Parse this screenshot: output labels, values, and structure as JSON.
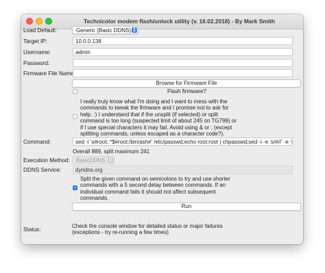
{
  "window": {
    "title": "Technicolor modem flash/unlock utility (v. 16.02.2018) - By Mark Smith"
  },
  "form": {
    "load_default": {
      "label": "Load Default:",
      "selected": "Generic (Basic DDNS)"
    },
    "target_ip": {
      "label": "Target IP:",
      "value": "10.0.0.138"
    },
    "username": {
      "label": "Username:",
      "value": "admin"
    },
    "password": {
      "label": "Password:",
      "value": ""
    },
    "firmware_file": {
      "label": "Firmware File Name:",
      "value": ""
    },
    "browse_button": "Browse for Firmware File",
    "flash_firmware": {
      "label": "Flash firmware?",
      "checked": false
    },
    "disclaimer": {
      "lines": [
        "I really truly know what I'm doing and I want to mess with the",
        "commands to tweak the firmware and I promise not to ask for",
        "help. :)  I understand that if the unsplit (if selected) or split",
        "command is too long (suspected limit of about 245 on TG799) or",
        "if I use special characters it may fail.  Avoid using & or ; (except",
        "splitting commands, unless escaped as a character code?)."
      ],
      "checked": false
    },
    "command": {
      "label": "Command:",
      "value": "sed -i 's#root:.*$#root:/bin/ash#' /etc/passwd;echo root:root | chpasswd;sed -i -e 's/#//' -e 's#",
      "info": "Overall 889, split maximum 241"
    },
    "execution_method": {
      "label": "Execution Method:",
      "selected": "BasicDDNS"
    },
    "ddns_service": {
      "label": "DDNS Service:",
      "value": "dyndns.org"
    },
    "split_command": {
      "lines": [
        "Split the given command on semicolons to try and use shorter",
        "commands with a 5 second delay between commands.  If an",
        "individual command fails it should not affect subsequent",
        "commands."
      ],
      "checked": true
    },
    "run_button": "Run",
    "status": {
      "label": "Status:",
      "lines": [
        "Check the console window for detailed status or major failures",
        "(exceptions - try re-running a few times)"
      ]
    }
  },
  "colors": {
    "accent": "#2f7ff7",
    "close": "#fc5f57",
    "minimize": "#fdbc2e",
    "maximize": "#28c840"
  }
}
